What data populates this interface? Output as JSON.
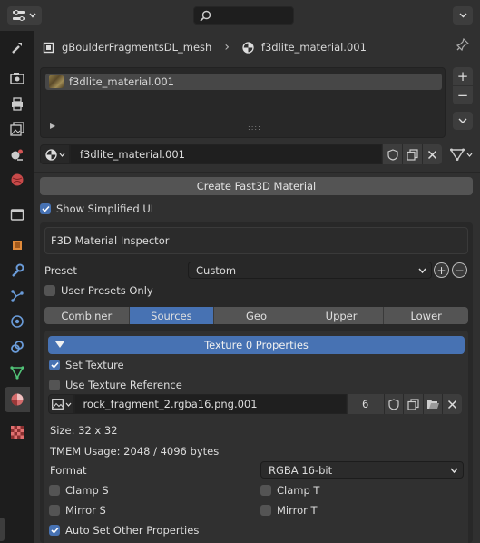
{
  "header": {
    "search_placeholder": ""
  },
  "breadcrumb": {
    "object": "gBoulderFragmentsDL_mesh",
    "separator": "›",
    "material": "f3dlite_material.001"
  },
  "slots": [
    {
      "label": "f3dlite_material.001"
    }
  ],
  "list_grip": "::::",
  "material_field": "f3dlite_material.001",
  "create_button": "Create Fast3D Material",
  "show_simplified": {
    "label": "Show Simplified UI",
    "checked": true
  },
  "inspector": {
    "title": "F3D Material Inspector",
    "preset_label": "Preset",
    "preset_value": "Custom",
    "user_presets": {
      "label": "User Presets Only",
      "checked": false
    },
    "tabs": [
      "Combiner",
      "Sources",
      "Geo",
      "Upper",
      "Lower"
    ],
    "active_tab": "Sources"
  },
  "texture": {
    "header": "Texture 0 Properties",
    "set_texture": {
      "label": "Set Texture",
      "checked": true
    },
    "use_reference": {
      "label": "Use Texture Reference",
      "checked": false
    },
    "image_name": "rock_fragment_2.rgba16.png.001",
    "users": "6",
    "size": "Size: 32 x 32",
    "tmem": "TMEM Usage: 2048 / 4096 bytes",
    "format_label": "Format",
    "format_value": "RGBA 16-bit",
    "clamp_s": "Clamp S",
    "clamp_t": "Clamp T",
    "mirror_s": "Mirror S",
    "mirror_t": "Mirror T",
    "auto_set": {
      "label": "Auto Set Other Properties",
      "checked": true
    }
  },
  "colors": {
    "accent": "#4772b3",
    "panel": "#303030",
    "background": "#1d1d1d"
  },
  "icons": {
    "tabs": [
      "tool-icon",
      "render-icon",
      "output-icon",
      "view-layer-icon",
      "scene-icon",
      "world-icon",
      "collection-icon",
      "object-icon",
      "modifier-icon",
      "particles-icon",
      "physics-icon",
      "constraints-icon",
      "data-icon",
      "material-icon",
      "texture-icon"
    ]
  }
}
